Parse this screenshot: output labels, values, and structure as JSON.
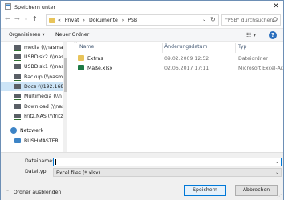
{
  "window": {
    "title": "Speichern unter",
    "close_glyph": "✕"
  },
  "nav_buttons": {
    "back": "←",
    "forward": "→",
    "up_dropdown": "⌄",
    "up": "↑"
  },
  "address": {
    "crumbs": [
      "«",
      "Privat",
      "›",
      "Dokumente",
      "›",
      "PSB"
    ],
    "dropdown": "⌄",
    "refresh": "↻"
  },
  "search": {
    "placeholder": "\"PSB\" durchsuchen",
    "icon": "search-icon"
  },
  "toolbar": {
    "organize": "Organisieren ▾",
    "new_folder": "Neuer Ordner",
    "view": "☷ ▾",
    "help": "?"
  },
  "nav_items": [
    {
      "label": "media (\\\\nasma",
      "icon": "network-drive-icon"
    },
    {
      "label": "USBDisk2 (\\\\nas",
      "icon": "network-drive-icon"
    },
    {
      "label": "USBDisk1 (\\\\nas",
      "icon": "network-drive-icon"
    },
    {
      "label": "Backup (\\\\nasm",
      "icon": "network-drive-icon"
    },
    {
      "label": "Docs (\\\\192.168.",
      "icon": "network-drive-icon",
      "selected": true
    },
    {
      "label": "Multimedia (\\\\n",
      "icon": "network-drive-icon"
    },
    {
      "label": "Download (\\\\nas",
      "icon": "network-drive-icon"
    },
    {
      "label": "Fritz.NAS (\\\\fritz",
      "icon": "network-drive-icon"
    },
    {
      "label": "Netzwerk",
      "icon": "network-icon"
    },
    {
      "label": "BUSHMASTER",
      "icon": "computer-icon"
    }
  ],
  "columns": {
    "name": "Name",
    "date": "Änderungsdatum",
    "type": "Typ"
  },
  "sort_indicator": "^",
  "files": [
    {
      "name": "Extras",
      "date": "09.02.2009 12:52",
      "type": "Dateiordner",
      "icon": "folder-icon"
    },
    {
      "name": "Maße.xlsx",
      "date": "02.06.2017 17:11",
      "type": "Microsoft Excel-Ar...",
      "icon": "excel-file-icon"
    }
  ],
  "form": {
    "filename_label": "Dateiname:",
    "filename_value": "",
    "filetype_label": "Dateityp:",
    "filetype_value": "Excel files (*.xlsx)",
    "dropdown": "⌄"
  },
  "footer": {
    "hide_folders": "Ordner ausblenden",
    "hide_chevron": "⌃",
    "save": "Speichern",
    "cancel": "Abbrechen"
  },
  "colors": {
    "accent": "#0078d7",
    "selection": "#cce4f7",
    "folder": "#e8c45a",
    "excel": "#1e7a45"
  }
}
